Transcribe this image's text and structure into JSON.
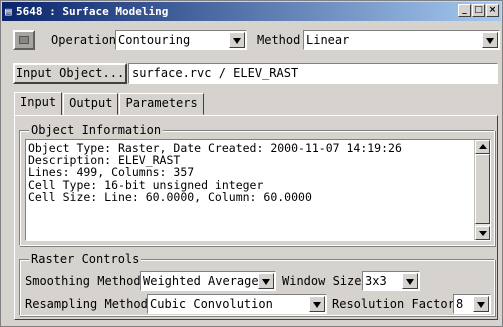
{
  "window": {
    "title": "5648 : Surface Modeling",
    "system_menu_icon": "window-menu-icon",
    "controls": [
      "minimize-icon",
      "maximize-icon",
      "close-icon"
    ]
  },
  "toolbar": {
    "operation_label": "Operation",
    "operation_value": "Contouring",
    "method_label": "Method",
    "method_value": "Linear"
  },
  "input_object": {
    "button_label": "Input Object...",
    "value": "surface.rvc / ELEV_RAST"
  },
  "tabs": [
    {
      "label": "Input",
      "active": true
    },
    {
      "label": "Output",
      "active": false
    },
    {
      "label": "Parameters",
      "active": false
    }
  ],
  "object_information": {
    "title": "Object Information",
    "lines": [
      "Object Type: Raster, Date Created: 2000-11-07 14:19:26",
      "Description: ELEV_RAST",
      "Lines: 499, Columns: 357",
      "Cell Type: 16-bit unsigned integer",
      "Cell Size: Line: 60.0000, Column: 60.0000"
    ]
  },
  "raster_controls": {
    "title": "Raster Controls",
    "smoothing_label": "Smoothing Method",
    "smoothing_value": "Weighted Average",
    "window_size_label": "Window Size",
    "window_size_value": "3x3",
    "resampling_label": "Resampling Method",
    "resampling_value": "Cubic Convolution",
    "resolution_label": "Resolution Factor",
    "resolution_value": "8"
  }
}
